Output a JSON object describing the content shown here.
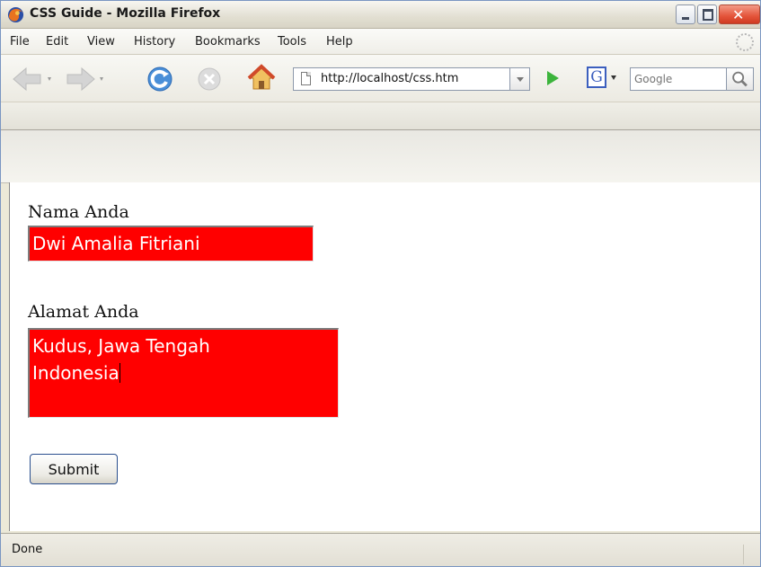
{
  "window": {
    "title": "CSS Guide - Mozilla Firefox",
    "app_icon": "firefox-icon",
    "controls": [
      "minimize-icon",
      "maximize-icon",
      "close-icon"
    ]
  },
  "menubar": {
    "items": [
      "File",
      "Edit",
      "View",
      "History",
      "Bookmarks",
      "Tools",
      "Help"
    ]
  },
  "navbar": {
    "back_icon": "back-arrow-icon",
    "forward_icon": "forward-arrow-icon",
    "reload_icon": "reload-icon",
    "stop_icon": "stop-icon",
    "home_icon": "home-icon",
    "url": "http://localhost/css.htm",
    "go_icon": "go-arrow-icon",
    "search_engine_icon": "google-g-icon",
    "search_placeholder": "Google",
    "search_icon": "magnifier-icon"
  },
  "form": {
    "name_label": "Nama Anda",
    "name_value": "Dwi Amalia Fitriani",
    "address_label": "Alamat Anda",
    "address_line1": "Kudus, Jawa Tengah",
    "address_line2": "Indonesia",
    "submit_label": "Submit",
    "field_background": "#ff0000",
    "field_text_color": "#ffffff"
  },
  "statusbar": {
    "text": "Done"
  }
}
